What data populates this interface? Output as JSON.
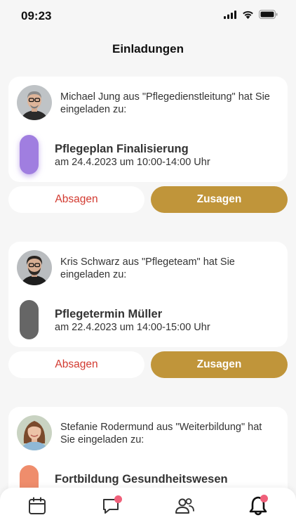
{
  "status_bar": {
    "time": "09:23",
    "icons": [
      "signal-icon",
      "wifi-icon",
      "battery-icon"
    ]
  },
  "header": {
    "title": "Einladungen"
  },
  "invitations": [
    {
      "inviter_text": "Michael Jung aus \"Pflegedienstleitung\" hat Sie eingeladen zu:",
      "event_title": "Pflegeplan Finalisierung",
      "event_time": "am 24.4.2023 um 10:00-14:00 Uhr",
      "event_color": "#a07ee0",
      "decline_label": "Absagen",
      "accept_label": "Zusagen"
    },
    {
      "inviter_text": "Kris Schwarz aus \"Pflegeteam\" hat Sie eingeladen zu:",
      "event_title": "Pflegetermin Müller",
      "event_time": "am 22.4.2023 um 14:00-15:00 Uhr",
      "event_color": "#666666",
      "decline_label": "Absagen",
      "accept_label": "Zusagen"
    },
    {
      "inviter_text": "Stefanie Rodermund aus \"Weiterbildung\" hat Sie eingeladen zu:",
      "event_title": "Fortbildung Gesundheitswesen",
      "event_time": "",
      "event_color": "#ef8d6c",
      "decline_label": "",
      "accept_label": ""
    }
  ],
  "tab_bar": {
    "tabs": [
      {
        "icon": "calendar-icon",
        "badge": false
      },
      {
        "icon": "chat-icon",
        "badge": true
      },
      {
        "icon": "people-icon",
        "badge": false
      },
      {
        "icon": "bell-icon",
        "badge": true,
        "active": true
      }
    ]
  },
  "colors": {
    "accent": "#c0953a",
    "decline": "#d23a30",
    "badge": "#f0607a",
    "background": "#f6f6f6"
  }
}
